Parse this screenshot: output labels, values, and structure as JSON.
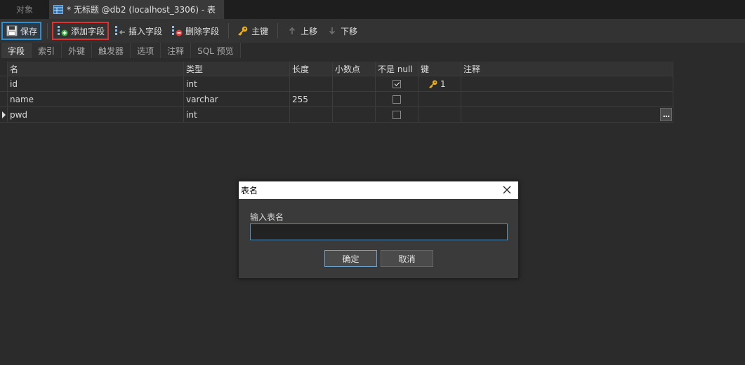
{
  "window_tabs": {
    "objects_label": "对象",
    "active_label": "* 无标题 @db2 (localhost_3306) - 表"
  },
  "toolbar": {
    "save_label": "保存",
    "add_field_label": "添加字段",
    "insert_field_label": "插入字段",
    "delete_field_label": "删除字段",
    "primary_key_label": "主键",
    "move_up_label": "上移",
    "move_down_label": "下移"
  },
  "subtabs": [
    "字段",
    "索引",
    "外键",
    "触发器",
    "选项",
    "注释",
    "SQL 预览"
  ],
  "grid": {
    "headers": {
      "name": "名",
      "type": "类型",
      "length": "长度",
      "decimals": "小数点",
      "not_null": "不是 null",
      "key": "键",
      "comment": "注释"
    },
    "rows": [
      {
        "name": "id",
        "type": "int",
        "length": "",
        "decimals": "",
        "not_null": true,
        "key": "1",
        "has_key_icon": true,
        "comment": "",
        "current": false
      },
      {
        "name": "name",
        "type": "varchar",
        "length": "255",
        "decimals": "",
        "not_null": false,
        "key": "",
        "has_key_icon": false,
        "comment": "",
        "current": false
      },
      {
        "name": "pwd",
        "type": "int",
        "length": "",
        "decimals": "",
        "not_null": false,
        "key": "",
        "has_key_icon": false,
        "comment": "",
        "current": true
      }
    ],
    "ellipsis_label": "..."
  },
  "dialog": {
    "title": "表名",
    "prompt_label": "输入表名",
    "input_value": "",
    "ok_label": "确定",
    "cancel_label": "取消"
  },
  "colors": {
    "accent_blue": "#2c8fd0",
    "highlight_red": "#e03030",
    "key_gold": "#e8b020"
  }
}
